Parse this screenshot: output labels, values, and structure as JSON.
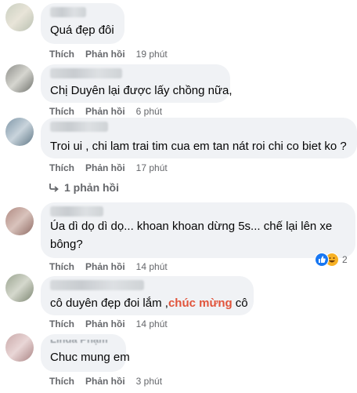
{
  "actions": {
    "like": "Thích",
    "reply": "Phản hồi"
  },
  "comments": [
    {
      "text": "Quá đẹp đôi",
      "time": "19 phút"
    },
    {
      "text": "Chị Duyên lại được lấy chồng nữa,",
      "time": "6 phút"
    },
    {
      "text": "Troi ui , chi lam trai tim cua em tan nát roi chi co biet ko ?",
      "time": "17 phút",
      "replies": "1 phản hồi"
    },
    {
      "line1": "Úa dì dọ dì dọ... khoan khoan dừng 5s... chế lại lên xe",
      "line2": "bông?",
      "time": "14 phút",
      "reaction_count": "2"
    },
    {
      "text_before": "cô duyên đẹp đoi lắm ,",
      "text_highlight": "chúc mừng",
      "text_after": " cô",
      "time": "14 phút"
    },
    {
      "name_partial": "Linda Phạm",
      "text": "Chuc mung em",
      "time": "3 phút"
    }
  ],
  "colors": {
    "bubble": "#f0f2f5",
    "meta": "#65676b",
    "highlight": "#e1543b",
    "like_blue": "#1877f2"
  },
  "icons": [
    "reply-arrow-icon",
    "like-reaction-icon",
    "haha-reaction-icon"
  ]
}
